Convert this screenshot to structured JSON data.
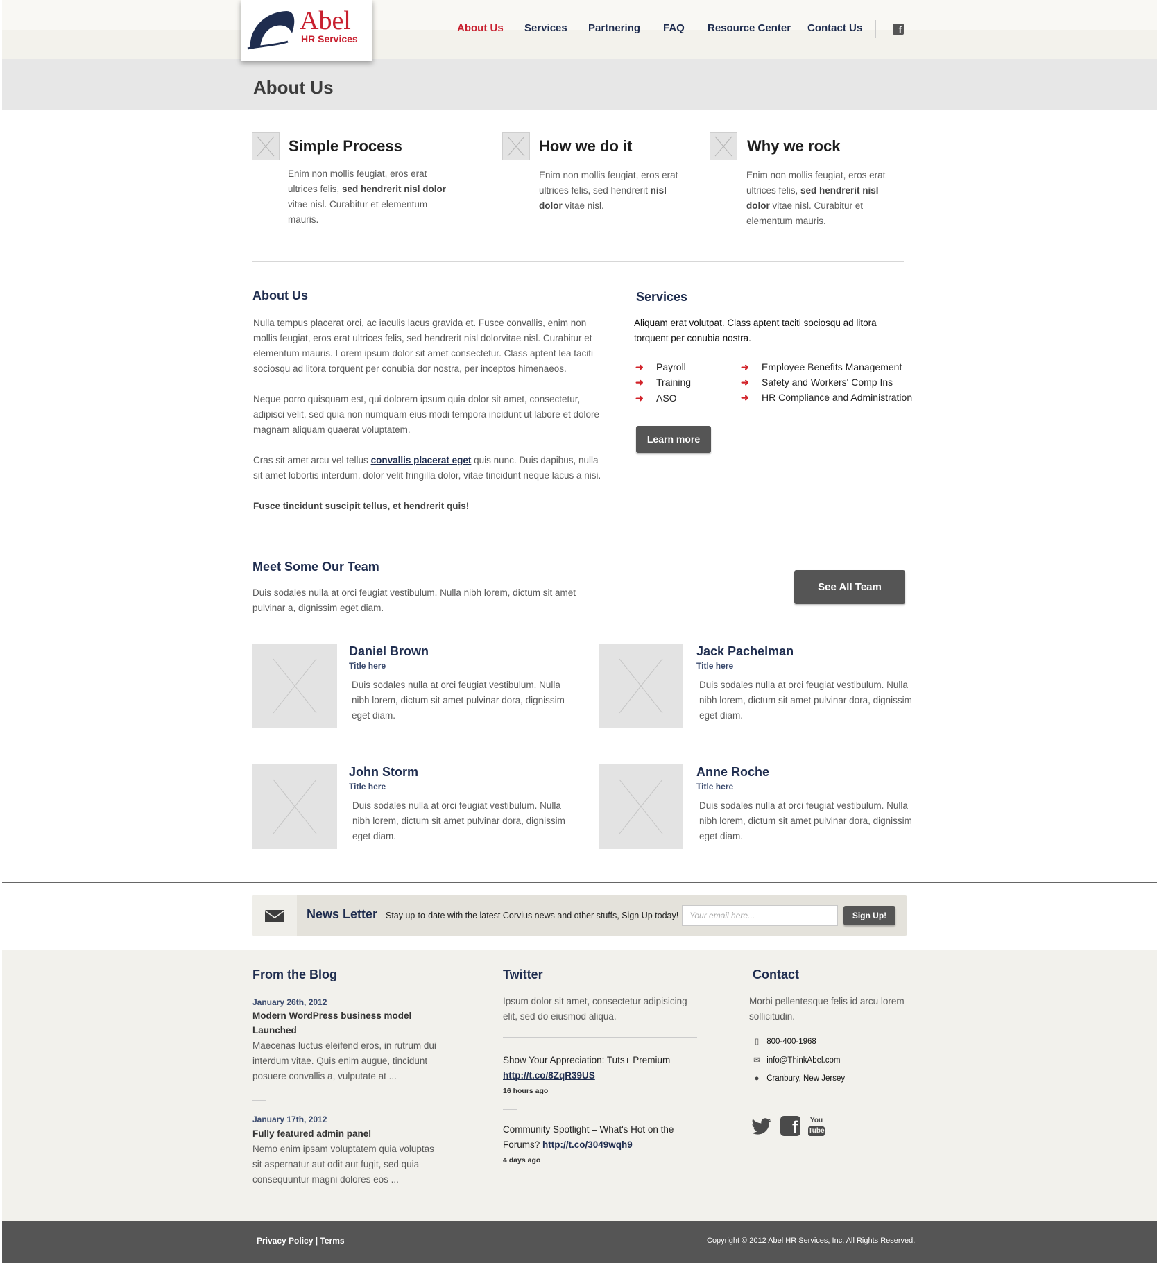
{
  "brand": {
    "logo_word": "Abel",
    "logo_sub": "HR Services",
    "accent": "#c8202f",
    "navy": "#1f2d4f"
  },
  "nav": {
    "items": [
      {
        "label": "About Us",
        "active": true
      },
      {
        "label": "Services"
      },
      {
        "label": "Partnering"
      },
      {
        "label": "FAQ"
      },
      {
        "label": "Resource Center"
      },
      {
        "label": "Contact Us"
      }
    ],
    "social_icon": "facebook-icon"
  },
  "page_title": "About Us",
  "features": [
    {
      "title": "Simple Process",
      "text_html": "Enim non mollis feugiat, eros erat ultrices felis, <b>sed hendrerit nisl dolor</b> vitae nisl. Curabitur et elementum mauris."
    },
    {
      "title": "How we do it",
      "text_html": "Enim non mollis feugiat, eros erat ultrices felis, sed hendrerit <b>nisl dolor</b> vitae nisl."
    },
    {
      "title": "Why we rock",
      "text_html": "Enim non mollis feugiat, eros erat ultrices felis, <b>sed hendrerit nisl dolor</b> vitae nisl. Curabitur et elementum mauris."
    }
  ],
  "about": {
    "heading": "About Us",
    "p1": "Nulla tempus placerat orci, ac iaculis lacus gravida et. Fusce convallis, enim non mollis feugiat, eros erat ultrices felis, sed hendrerit nisl dolorvitae nisl. Curabitur et elementum mauris. Lorem ipsum dolor sit amet consectetur. Class aptent lea taciti sociosqu ad litora torquent per conubia dor nostra, per inceptos himenaeos.",
    "p2": "Neque porro quisquam est, qui dolorem ipsum quia dolor sit amet, consectetur, adipisci velit, sed quia non numquam eius modi tempora incidunt ut labore et dolore magnam aliquam quaerat voluptatem.",
    "p3_before": "Cras sit amet arcu vel tellus ",
    "p3_link": "convallis placerat eget",
    "p3_after": " quis nunc. Duis dapibus, nulla sit amet lobortis interdum, dolor velit fringilla dolor, vitae tincidunt neque lacus a nisi.",
    "p4": "Fusce tincidunt suscipit tellus, et hendrerit quis!"
  },
  "services": {
    "heading": "Services",
    "intro": "Aliquam erat volutpat. Class aptent taciti sociosqu ad litora torquent per conubia nostra.",
    "col1": [
      "Payroll",
      "Training",
      "ASO"
    ],
    "col2": [
      "Employee Benefits Management",
      "Safety and Workers' Comp Ins",
      "HR Compliance and Administration"
    ],
    "button": "Learn more"
  },
  "team": {
    "heading": "Meet Some Our Team",
    "intro": "Duis sodales nulla at orci feugiat vestibulum. Nulla nibh lorem, dictum sit amet pulvinar a, dignissim eget diam.",
    "button": "See All Team",
    "members": [
      {
        "name": "Daniel Brown",
        "title": "Title here",
        "bio": "Duis sodales nulla at orci feugiat vestibulum. Nulla nibh lorem, dictum sit amet pulvinar dora, dignissim eget diam."
      },
      {
        "name": "Jack Pachelman",
        "title": "Title here",
        "bio": "Duis sodales nulla at orci feugiat vestibulum. Nulla nibh lorem, dictum sit amet pulvinar dora, dignissim eget diam."
      },
      {
        "name": "John Storm",
        "title": "Title here",
        "bio": "Duis sodales nulla at orci feugiat vestibulum. Nulla nibh lorem, dictum sit amet pulvinar dora, dignissim eget diam."
      },
      {
        "name": "Anne Roche",
        "title": "Title here",
        "bio": "Duis sodales nulla at orci feugiat vestibulum. Nulla nibh lorem, dictum sit amet pulvinar dora, dignissim eget diam."
      }
    ]
  },
  "newsletter": {
    "title": "News Letter",
    "text": "Stay up-to-date with the latest Corvius news and other stuffs, Sign Up today!",
    "placeholder": "Your email here...",
    "button": "Sign Up!",
    "icon": "envelope-icon"
  },
  "blog": {
    "heading": "From the Blog",
    "posts": [
      {
        "date": "January 26th, 2012",
        "title": "Modern WordPress business model Launched",
        "excerpt": "Maecenas luctus eleifend eros, in rutrum dui interdum vitae. Quis enim augue, tincidunt posuere convallis a, vulputate at ..."
      },
      {
        "date": "January 17th, 2012",
        "title": "Fully featured admin panel",
        "excerpt": "Nemo enim ipsam voluptatem quia voluptas sit aspernatur aut odit aut fugit, sed quia consequuntur magni dolores eos ..."
      }
    ]
  },
  "twitter": {
    "heading": "Twitter",
    "intro": "Ipsum dolor sit amet, consectetur adipisicing elit, sed do eiusmod aliqua.",
    "tweets": [
      {
        "text": "Show Your Appreciation: Tuts+ Premium ",
        "link": "http://t.co/8ZqR39US",
        "time": "16 hours ago"
      },
      {
        "text": "Community Spotlight – What's Hot on the Forums? ",
        "link": "http://t.co/3049wqh9",
        "time": "4 days ago"
      }
    ]
  },
  "contact": {
    "heading": "Contact",
    "intro": "Morbi pellentesque felis id arcu lorem sollicitudin.",
    "phone": "800-400-1968",
    "email": "info@ThinkAbel.com",
    "location": "Cranbury, New Jersey",
    "social": [
      "twitter-icon",
      "facebook-icon",
      "youtube-icon"
    ],
    "youtube_label": [
      "You",
      "Tube"
    ]
  },
  "footer": {
    "privacy": "Privacy Policy",
    "separator": "|",
    "terms": "Terms",
    "copyright": "Copyright © 2012 Abel HR Services, Inc. All Rights Reserved."
  }
}
